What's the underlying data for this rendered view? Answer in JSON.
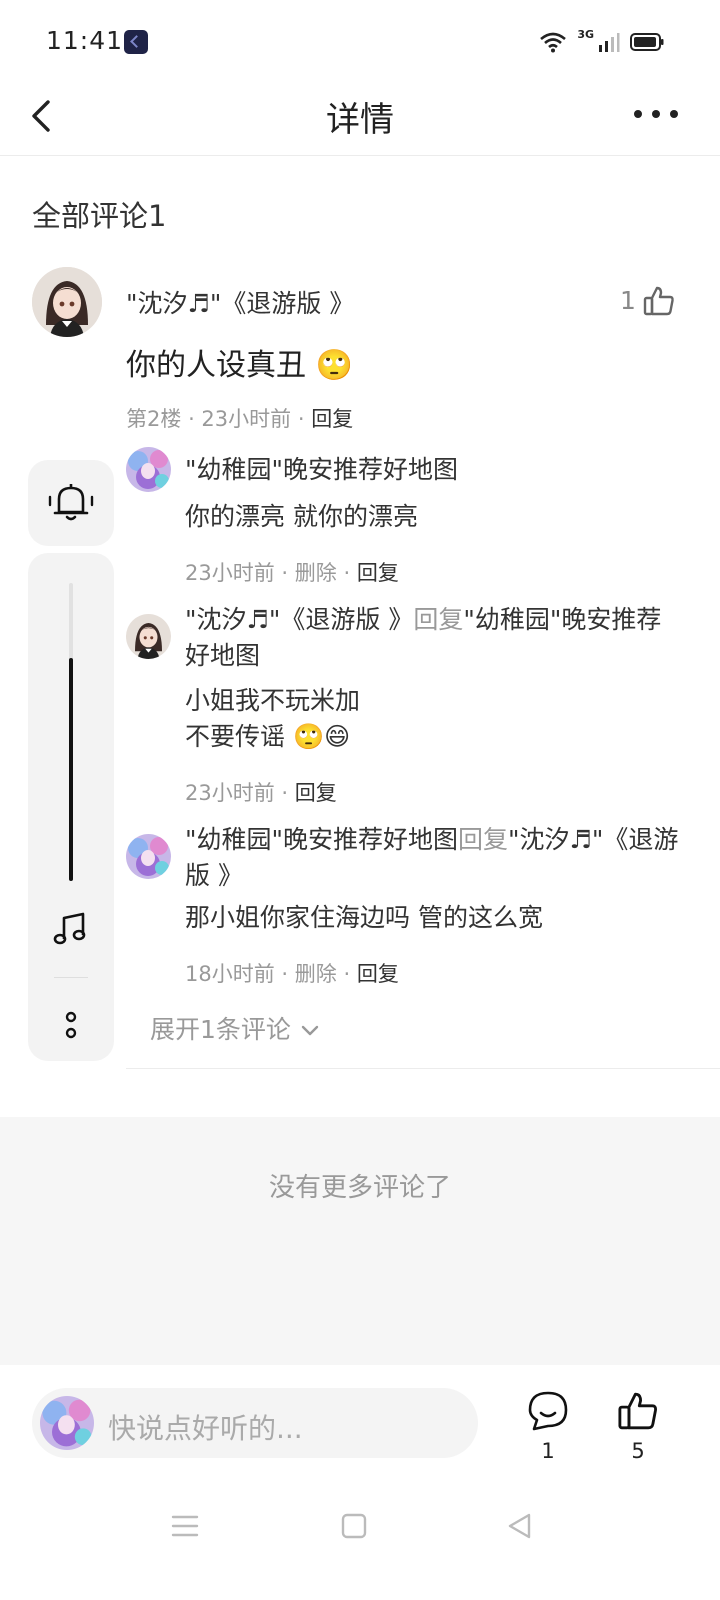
{
  "status": {
    "time": "11:41",
    "network": "3G"
  },
  "header": {
    "title": "详情"
  },
  "section": {
    "title": "全部评论1"
  },
  "main_comment": {
    "name": "\"沈汐♬\"《退游版 》",
    "likes": "1",
    "text": "你的人设真丑 🙄",
    "floor": "第2楼",
    "time": "23小时前",
    "reply_label": "回复"
  },
  "replies": [
    {
      "name": "\"幼稚园\"晚安推荐好地图",
      "text": "你的漂亮 就你的漂亮",
      "time": "23小时前",
      "delete_label": "删除",
      "reply_label": "回复"
    },
    {
      "name": "\"沈汐♬\"《退游版 》",
      "reply_word": "回复",
      "target": "\"幼稚园\"晚安推荐好地图",
      "text_line1": "小姐我不玩米加",
      "text_line2": "不要传谣 🙄😄",
      "time": "23小时前",
      "reply_label": "回复"
    },
    {
      "name": "\"幼稚园\"晚安推荐好地图",
      "reply_word": "回复",
      "target": "\"沈汐♬\"《退游版 》",
      "text": "那小姐你家住海边吗 管的这么宽",
      "time": "18小时前",
      "delete_label": "删除",
      "reply_label": "回复"
    }
  ],
  "expand_label": "展开1条评论",
  "no_more": "没有更多评论了",
  "bottom": {
    "placeholder": "快说点好听的...",
    "comment_count": "1",
    "like_count": "5"
  },
  "floating": {
    "volume_level": 0.75
  },
  "colors": {
    "accent_text": "#222222",
    "muted": "#999999",
    "panel_bg": "#f3f3f3"
  }
}
